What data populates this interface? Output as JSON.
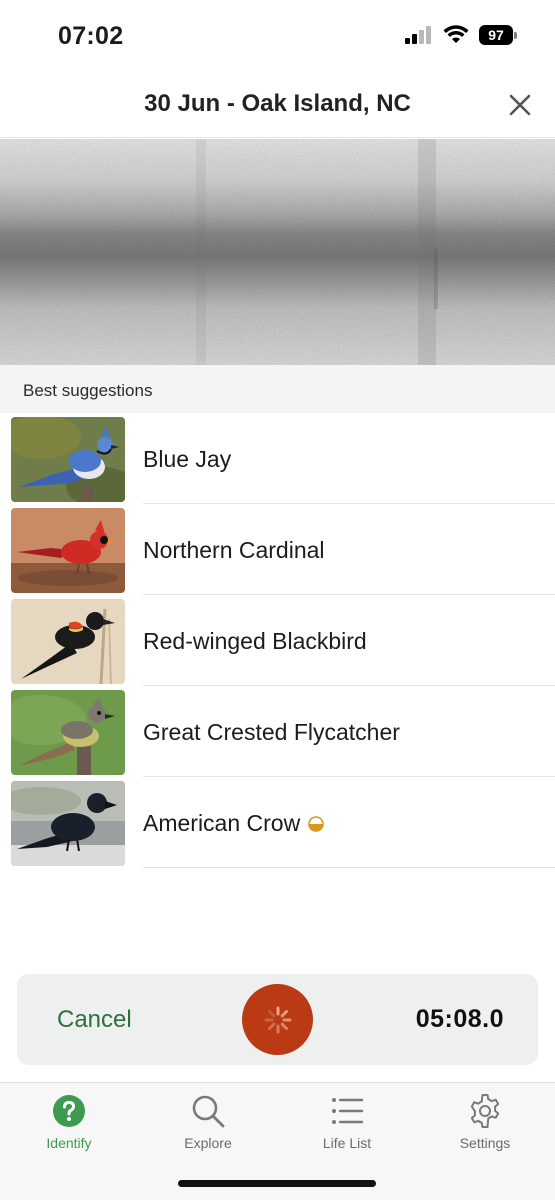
{
  "status_bar": {
    "time": "07:02",
    "battery": "97",
    "icons": [
      "signal-icon",
      "wifi-icon",
      "battery-icon"
    ]
  },
  "header": {
    "title": "30 Jun - Oak Island, NC",
    "close_icon": "close-icon"
  },
  "section": {
    "label": "Best suggestions"
  },
  "suggestions": [
    {
      "name": "Blue Jay",
      "image": "blue-jay-photo"
    },
    {
      "name": "Northern Cardinal",
      "image": "northern-cardinal-photo"
    },
    {
      "name": "Red-winged Blackbird",
      "image": "red-winged-blackbird-photo"
    },
    {
      "name": "Great Crested Flycatcher",
      "image": "great-crested-flycatcher-photo"
    },
    {
      "name": "American Crow",
      "image": "american-crow-photo",
      "badge_icon": "half-circle-icon"
    }
  ],
  "recorder": {
    "cancel_label": "Cancel",
    "elapsed": "05:08.0",
    "button_icon": "spinner-icon"
  },
  "tabs": [
    {
      "label": "Identify",
      "icon": "question-icon",
      "active": true
    },
    {
      "label": "Explore",
      "icon": "search-icon",
      "active": false
    },
    {
      "label": "Life List",
      "icon": "list-icon",
      "active": false
    },
    {
      "label": "Settings",
      "icon": "gear-icon",
      "active": false
    }
  ],
  "colors": {
    "accent_green": "#3d9a4f",
    "cancel_green": "#2e6f3c",
    "record_red": "#b93a14",
    "badge_gold": "#d79a18"
  }
}
